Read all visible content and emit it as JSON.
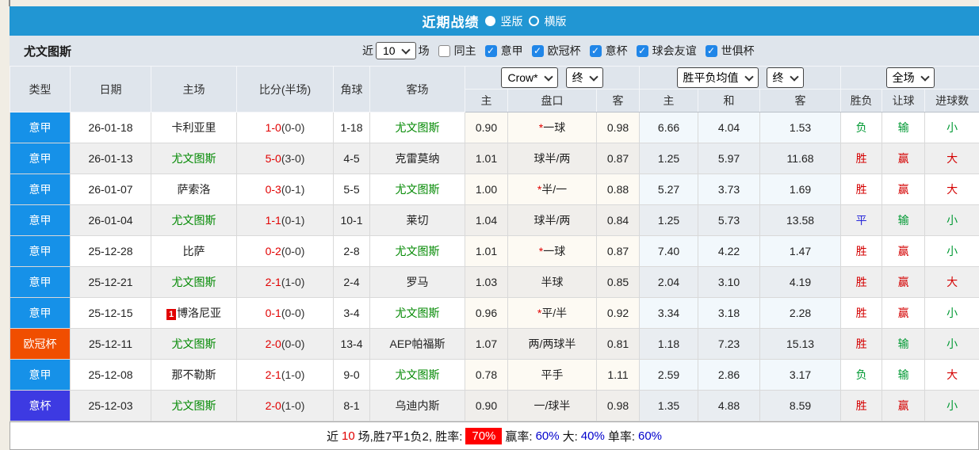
{
  "title_bar": {
    "title": "近期战绩",
    "vertical_label": "竖版",
    "horizontal_label": "横版"
  },
  "filter_bar": {
    "team": "尤文图斯",
    "near_label": "近",
    "matches_count": "10",
    "unit_label": "场",
    "same_home_label": "同主",
    "leagues": [
      {
        "label": "意甲",
        "state": "checked"
      },
      {
        "label": "欧冠杯",
        "state": "checked"
      },
      {
        "label": "意杯",
        "state": "checked"
      },
      {
        "label": "球会友谊",
        "state": "checked"
      },
      {
        "label": "世俱杯",
        "state": "checked"
      }
    ]
  },
  "table": {
    "col_headers": {
      "type": "类型",
      "date": "日期",
      "home": "主场",
      "score": "比分(半场)",
      "corner": "角球",
      "away": "客场",
      "h": "主",
      "handicap": "盘口",
      "a": "客",
      "w": "主",
      "d": "和",
      "l": "客",
      "wdl": "胜负",
      "ah": "让球",
      "goals": "进球数"
    },
    "selects": {
      "company": "Crow*",
      "time1": "终",
      "avg": "胜平负均值",
      "time2": "终",
      "scope": "全场"
    },
    "rows": [
      {
        "type": "意甲",
        "type_class": "serie",
        "date": "26-01-18",
        "red_card": "",
        "home": "卡利亚里",
        "home_class": "",
        "score": "1-0",
        "half": "(0-0)",
        "corner": "1-18",
        "away": "尤文图斯",
        "away_class": "juve",
        "h_odds": "0.90",
        "star": "*",
        "handicap": "一球",
        "a_odds": "0.98",
        "avg_w": "6.66",
        "avg_d": "4.04",
        "avg_l": "1.53",
        "wdl": "负",
        "wdl_class": "c-green",
        "ah": "输",
        "ah_class": "c-green",
        "goal": "小",
        "goal_class": "c-green"
      },
      {
        "type": "意甲",
        "type_class": "serie",
        "date": "26-01-13",
        "red_card": "",
        "home": "尤文图斯",
        "home_class": "juve",
        "score": "5-0",
        "half": "(3-0)",
        "corner": "4-5",
        "away": "克雷莫纳",
        "away_class": "",
        "h_odds": "1.01",
        "star": "",
        "handicap": "球半/两",
        "a_odds": "0.87",
        "avg_w": "1.25",
        "avg_d": "5.97",
        "avg_l": "11.68",
        "wdl": "胜",
        "wdl_class": "c-red",
        "ah": "赢",
        "ah_class": "c-red",
        "goal": "大",
        "goal_class": "c-red"
      },
      {
        "type": "意甲",
        "type_class": "serie",
        "date": "26-01-07",
        "red_card": "",
        "home": "萨索洛",
        "home_class": "",
        "score": "0-3",
        "half": "(0-1)",
        "corner": "5-5",
        "away": "尤文图斯",
        "away_class": "juve",
        "h_odds": "1.00",
        "star": "*",
        "handicap": "半/一",
        "a_odds": "0.88",
        "avg_w": "5.27",
        "avg_d": "3.73",
        "avg_l": "1.69",
        "wdl": "胜",
        "wdl_class": "c-red",
        "ah": "赢",
        "ah_class": "c-red",
        "goal": "大",
        "goal_class": "c-red"
      },
      {
        "type": "意甲",
        "type_class": "serie",
        "date": "26-01-04",
        "red_card": "",
        "home": "尤文图斯",
        "home_class": "juve",
        "score": "1-1",
        "half": "(0-1)",
        "corner": "10-1",
        "away": "莱切",
        "away_class": "",
        "h_odds": "1.04",
        "star": "",
        "handicap": "球半/两",
        "a_odds": "0.84",
        "avg_w": "1.25",
        "avg_d": "5.73",
        "avg_l": "13.58",
        "wdl": "平",
        "wdl_class": "c-blue",
        "ah": "输",
        "ah_class": "c-green",
        "goal": "小",
        "goal_class": "c-green"
      },
      {
        "type": "意甲",
        "type_class": "serie",
        "date": "25-12-28",
        "red_card": "",
        "home": "比萨",
        "home_class": "",
        "score": "0-2",
        "half": "(0-0)",
        "corner": "2-8",
        "away": "尤文图斯",
        "away_class": "juve",
        "h_odds": "1.01",
        "star": "*",
        "handicap": "一球",
        "a_odds": "0.87",
        "avg_w": "7.40",
        "avg_d": "4.22",
        "avg_l": "1.47",
        "wdl": "胜",
        "wdl_class": "c-red",
        "ah": "赢",
        "ah_class": "c-red",
        "goal": "小",
        "goal_class": "c-green"
      },
      {
        "type": "意甲",
        "type_class": "serie",
        "date": "25-12-21",
        "red_card": "",
        "home": "尤文图斯",
        "home_class": "juve",
        "score": "2-1",
        "half": "(1-0)",
        "corner": "2-4",
        "away": "罗马",
        "away_class": "",
        "h_odds": "1.03",
        "star": "",
        "handicap": "半球",
        "a_odds": "0.85",
        "avg_w": "2.04",
        "avg_d": "3.10",
        "avg_l": "4.19",
        "wdl": "胜",
        "wdl_class": "c-red",
        "ah": "赢",
        "ah_class": "c-red",
        "goal": "大",
        "goal_class": "c-red"
      },
      {
        "type": "意甲",
        "type_class": "serie",
        "date": "25-12-15",
        "red_card": "1",
        "home": "博洛尼亚",
        "home_class": "",
        "score": "0-1",
        "half": "(0-0)",
        "corner": "3-4",
        "away": "尤文图斯",
        "away_class": "juve",
        "h_odds": "0.96",
        "star": "*",
        "handicap": "平/半",
        "a_odds": "0.92",
        "avg_w": "3.34",
        "avg_d": "3.18",
        "avg_l": "2.28",
        "wdl": "胜",
        "wdl_class": "c-red",
        "ah": "赢",
        "ah_class": "c-red",
        "goal": "小",
        "goal_class": "c-green"
      },
      {
        "type": "欧冠杯",
        "type_class": "ucl",
        "date": "25-12-11",
        "red_card": "",
        "home": "尤文图斯",
        "home_class": "juve",
        "score": "2-0",
        "half": "(0-0)",
        "corner": "13-4",
        "away": "AEP帕福斯",
        "away_class": "",
        "h_odds": "1.07",
        "star": "",
        "handicap": "两/两球半",
        "a_odds": "0.81",
        "avg_w": "1.18",
        "avg_d": "7.23",
        "avg_l": "15.13",
        "wdl": "胜",
        "wdl_class": "c-red",
        "ah": "输",
        "ah_class": "c-green",
        "goal": "小",
        "goal_class": "c-green"
      },
      {
        "type": "意甲",
        "type_class": "serie",
        "date": "25-12-08",
        "red_card": "",
        "home": "那不勒斯",
        "home_class": "",
        "score": "2-1",
        "half": "(1-0)",
        "corner": "9-0",
        "away": "尤文图斯",
        "away_class": "juve",
        "h_odds": "0.78",
        "star": "",
        "handicap": "平手",
        "a_odds": "1.11",
        "avg_w": "2.59",
        "avg_d": "2.86",
        "avg_l": "3.17",
        "wdl": "负",
        "wdl_class": "c-green",
        "ah": "输",
        "ah_class": "c-green",
        "goal": "大",
        "goal_class": "c-red"
      },
      {
        "type": "意杯",
        "type_class": "coppa",
        "date": "25-12-03",
        "red_card": "",
        "home": "尤文图斯",
        "home_class": "juve",
        "score": "2-0",
        "half": "(1-0)",
        "corner": "8-1",
        "away": "乌迪内斯",
        "away_class": "",
        "h_odds": "0.90",
        "star": "",
        "handicap": "一/球半",
        "a_odds": "0.98",
        "avg_w": "1.35",
        "avg_d": "4.88",
        "avg_l": "8.59",
        "wdl": "胜",
        "wdl_class": "c-red",
        "ah": "赢",
        "ah_class": "c-red",
        "goal": "小",
        "goal_class": "c-green"
      }
    ]
  },
  "footer": {
    "parts": [
      {
        "text": "近",
        "cls": "t-black"
      },
      {
        "text": "10",
        "cls": "t-red"
      },
      {
        "text": "场,胜7平1负2, 胜率:",
        "cls": "t-black"
      },
      {
        "text": "70%",
        "cls": "redbox"
      },
      {
        "text": "赢率:",
        "cls": "t-black"
      },
      {
        "text": "60%",
        "cls": "t-blue"
      },
      {
        "text": "大:",
        "cls": "t-black"
      },
      {
        "text": "40%",
        "cls": "t-blue"
      },
      {
        "text": "单率:",
        "cls": "t-black"
      },
      {
        "text": "60%",
        "cls": "t-blue"
      }
    ]
  },
  "colors": {
    "title_bar_blue": "#2196d3",
    "serie_a_badge": "#1691e8",
    "ucl_badge": "#f04e00",
    "coppa_badge": "#3d3ae2",
    "win_red": "#d40000",
    "lose_green": "#009933",
    "draw_blue": "#2626d9",
    "juve_green": "#008800",
    "score_red": "#e10000",
    "footer_pct_blue": "#0000cc",
    "rate_box_red": "#ff0000",
    "header_bg": "#dfe5ec",
    "alt_row_bg": "#efefef"
  }
}
